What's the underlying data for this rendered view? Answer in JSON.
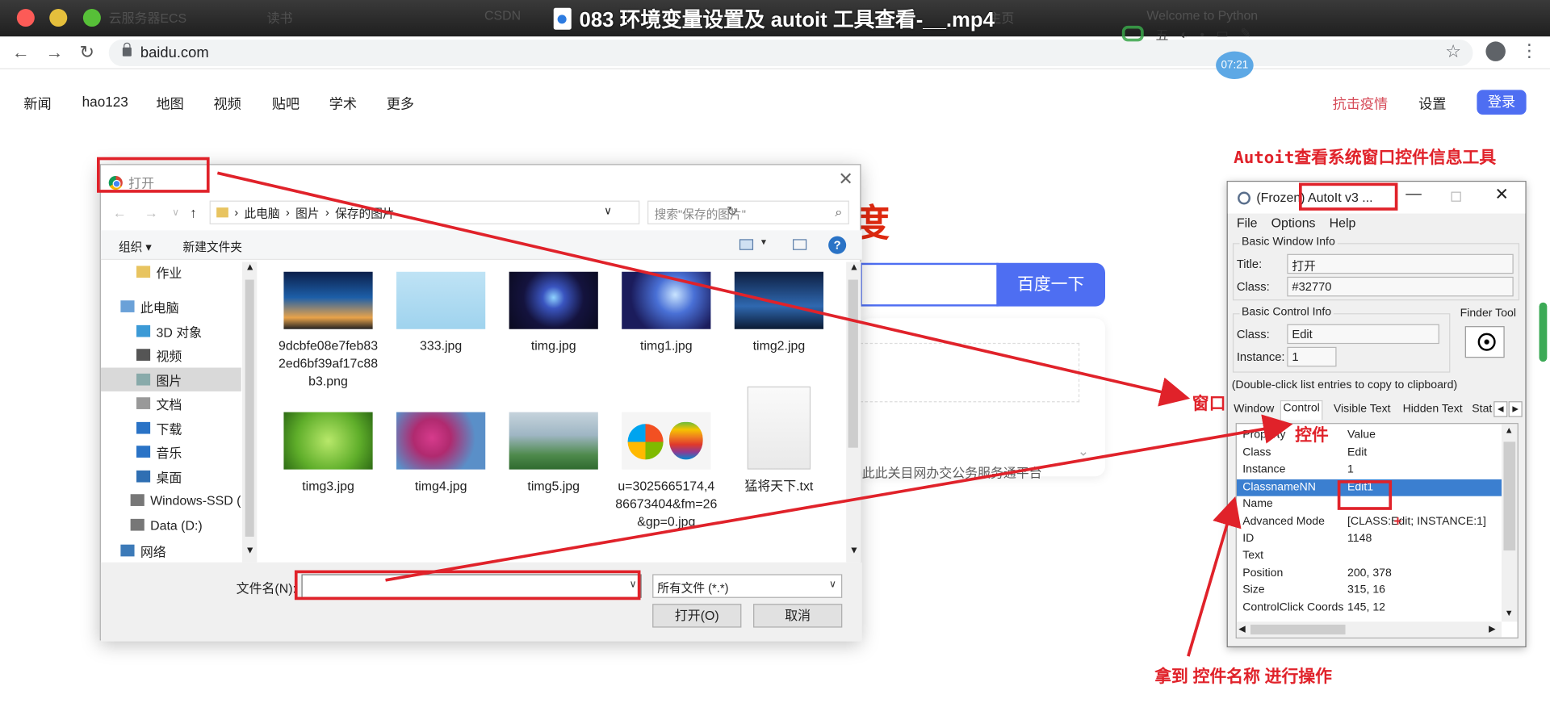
{
  "video": {
    "title": "083 环境变量设置及 autoit 工具查看-__.mp4"
  },
  "ghost_tabs": [
    "云服务器ECS",
    "读书",
    "CSDN",
    "主页",
    "Welcome to Python"
  ],
  "browser": {
    "url": "baidu.com"
  },
  "float_toolbar": {
    "item1": "五",
    "time": "07:21"
  },
  "baidu": {
    "nav": [
      "新闻",
      "hao123",
      "地图",
      "视频",
      "贴吧",
      "学术",
      "更多"
    ],
    "right_links": {
      "anti": "抗击疫情",
      "settings": "设置",
      "login": "登录"
    },
    "search_button": "百度一下",
    "logo_fragment": "度",
    "fragment_text": "此此关目网办交公务服务通平台"
  },
  "open_dialog": {
    "title": "打开",
    "breadcrumb": [
      "此电脑",
      "图片",
      "保存的图片"
    ],
    "search_placeholder": "搜索\"保存的图片\"",
    "toolbar": {
      "organize": "组织 ▾",
      "new_folder": "新建文件夹"
    },
    "sidebar": [
      "作业",
      "此电脑",
      "3D 对象",
      "视频",
      "图片",
      "文档",
      "下载",
      "音乐",
      "桌面",
      "Windows-SSD (",
      "Data (D:)",
      "网络"
    ],
    "sidebar_selected": "图片",
    "files": [
      {
        "name": "9dcbfe08e7feb832ed6bf39af17c88b3.png"
      },
      {
        "name": "333.jpg"
      },
      {
        "name": "timg.jpg"
      },
      {
        "name": "timg1.jpg"
      },
      {
        "name": "timg2.jpg"
      },
      {
        "name": "timg3.jpg"
      },
      {
        "name": "timg4.jpg"
      },
      {
        "name": "timg5.jpg"
      },
      {
        "name": "u=3025665174,486673404&fm=26&gp=0.jpg"
      },
      {
        "name": "猛将天下.txt"
      }
    ],
    "filename_label": "文件名(N):",
    "filename_value": "",
    "filetype": "所有文件 (*.*)",
    "open_button": "打开(O)",
    "cancel_button": "取消"
  },
  "autoit": {
    "window_title": "(Frozen) AutoIt v3 ...",
    "menu": [
      "File",
      "Options",
      "Help"
    ],
    "basic_window_info": {
      "label": "Basic Window Info",
      "title_label": "Title:",
      "title_value": "打开",
      "class_label": "Class:",
      "class_value": "#32770"
    },
    "basic_control_info": {
      "label": "Basic Control Info",
      "class_label": "Class:",
      "class_value": "Edit",
      "instance_label": "Instance:",
      "instance_value": "1"
    },
    "finder_tool": "Finder Tool",
    "hint": "(Double-click list entries to copy to clipboard)",
    "tabs": [
      "Window",
      "Control",
      "Visible Text",
      "Hidden Text",
      "Stat"
    ],
    "active_tab": "Control",
    "list_header": {
      "property": "Property",
      "value": "Value"
    },
    "rows": [
      {
        "property": "Class",
        "value": "Edit"
      },
      {
        "property": "Instance",
        "value": "1"
      },
      {
        "property": "ClassnameNN",
        "value": "Edit1"
      },
      {
        "property": "Name",
        "value": ""
      },
      {
        "property": "Advanced Mode",
        "value": "[CLASS:Edit; INSTANCE:1]"
      },
      {
        "property": "ID",
        "value": "1148"
      },
      {
        "property": "Text",
        "value": ""
      },
      {
        "property": "Position",
        "value": "200, 378"
      },
      {
        "property": "Size",
        "value": "315, 16"
      },
      {
        "property": "ControlClick Coords",
        "value": "145, 12"
      }
    ],
    "selected_row": "ClassnameNN"
  },
  "annotations": {
    "title": "Autoit查看系统窗口控件信息工具",
    "window": "窗口",
    "control": "控件",
    "bottom": "拿到 控件名称 进行操作",
    "color": "#e0222a"
  }
}
